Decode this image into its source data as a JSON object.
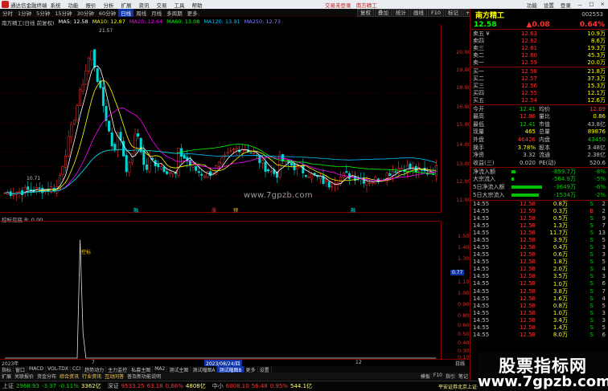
{
  "titlebar": {
    "app": "通达信金融终端",
    "menu": [
      "系统",
      "功能",
      "报价",
      "分析",
      "扩展",
      "资讯",
      "交易",
      "工具",
      "帮助"
    ],
    "notice": "交易未登录",
    "stock": "南方精工",
    "right": [
      "功能",
      "设置",
      "登录",
      "－",
      "□",
      "×"
    ]
  },
  "periodbar": {
    "items": [
      "分时",
      "1分钟",
      "5分钟",
      "15分钟",
      "30分钟",
      "60分钟",
      "日线",
      "周线",
      "月线",
      "多周期",
      "更多"
    ],
    "active": "日线"
  },
  "toolbtns": [
    "复权",
    "叠加",
    "统计",
    "画线",
    "F10",
    "标记",
    "+自选",
    "返回"
  ],
  "chart": {
    "title": "南方精工(日线 前复权)",
    "ma5": "MA5: 12.58",
    "ma10": "MA10: 12.87",
    "ma20": "MA20: 12.64",
    "ma60": "MA60: 13.08",
    "ma120": "MA120: 13.91",
    "ma250": "MA250: 12.73",
    "high_label": "21.57",
    "low_label": "10.71",
    "watermark": "www.7gpzb.com",
    "price_axis": [
      "20.00",
      "19.00",
      "18.00",
      "16.00",
      "15.00",
      "14.00",
      "13.00",
      "12.00",
      "11.00"
    ],
    "markers": [
      "融",
      "涨",
      "预",
      "融"
    ]
  },
  "sub": {
    "title": "控标见底  B: 0.00",
    "axis": [
      "1.50",
      "1.40",
      "1.30",
      "1.10",
      "1.00",
      "0.90",
      "0.80",
      "0.60",
      "0.50",
      "0.40",
      "0.30",
      "0.10"
    ],
    "marker": "0.77",
    "peak_label": "控标"
  },
  "dates": {
    "left": "2023年",
    "d1": "7",
    "cursor": "2023/08/24/四",
    "d2": "12",
    "right": "日线"
  },
  "indbar": {
    "items": [
      "指标",
      "窗口",
      "MACD",
      "VOL-TDX",
      "CCI",
      "趋势动力",
      "主力监控",
      "私募主图",
      "MA2",
      "测试主图",
      "测试幅图A",
      "测试幅图B",
      "更多",
      "设置"
    ],
    "active": "测试幅图B"
  },
  "tabbar": {
    "items": [
      "扩展",
      "关联报价",
      "资金分布",
      "综合资讯",
      "行业资讯",
      "互动问答",
      "普及新功能说明"
    ],
    "highlight": [
      "综合资讯",
      "行业资讯",
      "互动问答"
    ],
    "right": [
      "模板",
      "F10",
      "指引",
      "笔记"
    ]
  },
  "statusbar": {
    "sh": {
      "name": "上证",
      "val": "2968.93",
      "chg": "-3.37",
      "pct": "-0.11%",
      "amt": "3362亿"
    },
    "sz": {
      "name": "深证",
      "val": "9533.25",
      "chg": "63.18",
      "pct": "0.66%",
      "amt": "4808亿"
    },
    "zx": {
      "name": "中小",
      "val": "6008.10",
      "chg": "56.48",
      "pct": "0.95%",
      "amt": "544.1亿"
    },
    "news": "平安证券北京上证云行情"
  },
  "quote": {
    "name": "南方精工",
    "code": "002553",
    "price": "12.58",
    "change": "▲0.08",
    "pct": "0.64%",
    "asks": [
      {
        "label": "卖五 ¥",
        "price": "12.63",
        "vol": "10.9万"
      },
      {
        "label": "卖四",
        "price": "12.62",
        "vol": "8.6万"
      },
      {
        "label": "卖三",
        "price": "12.61",
        "vol": "19.3万"
      },
      {
        "label": "卖二",
        "price": "12.60",
        "vol": "45.3万"
      },
      {
        "label": "卖一",
        "price": "12.59",
        "vol": "20.0万"
      }
    ],
    "bids": [
      {
        "label": "买一",
        "price": "12.58",
        "vol": "21.8万"
      },
      {
        "label": "买二",
        "price": "12.57",
        "vol": "37.3万"
      },
      {
        "label": "买三",
        "price": "12.56",
        "vol": "15.3万"
      },
      {
        "label": "买四",
        "price": "12.55",
        "vol": "12.1万"
      },
      {
        "label": "买五",
        "price": "12.54",
        "vol": "12.6万"
      }
    ],
    "stats": [
      {
        "a": "今开",
        "b": "12.41",
        "c": "均价",
        "d": "12.69"
      },
      {
        "a": "最高",
        "b": "12.86",
        "c": "量比",
        "d": "0.86"
      },
      {
        "a": "最低",
        "b": "12.41",
        "c": "市值",
        "d": "43.8亿"
      },
      {
        "a": "现量",
        "b": "465",
        "c": "总量",
        "d": "89876"
      },
      {
        "a": "外盘",
        "b": "46426",
        "c": "内盘",
        "d": "43450"
      },
      {
        "a": "换手",
        "b": "3.78%",
        "c": "股本",
        "d": "3.48亿"
      },
      {
        "a": "净资",
        "b": "3.32",
        "c": "流通",
        "d": "2.38亿"
      },
      {
        "a": "收益(三)",
        "b": "0.020",
        "c": "PE(动)",
        "d": "520.6"
      }
    ],
    "flows": [
      {
        "a": "净流入额",
        "b": "-859.7万",
        "c": "-8%",
        "w": 0.12
      },
      {
        "a": "大宗流入",
        "b": "-564.9万",
        "c": "-5%",
        "w": 0.08
      },
      {
        "a": "5日净流入额",
        "b": "-3649万",
        "c": "-6%",
        "w": 0.95
      },
      {
        "a": "5日大宗流入",
        "b": "-1534万",
        "c": "-2%",
        "w": 0.85
      }
    ],
    "ticks": [
      {
        "t": "14:55",
        "p": "12.58",
        "v": "0.8万",
        "s": "S",
        "n": "2"
      },
      {
        "t": "14:55",
        "p": "12.59",
        "v": "0.3万",
        "s": "B",
        "n": "2"
      },
      {
        "t": "14:55",
        "p": "12.58",
        "v": "0.5万",
        "s": "S",
        "n": "9"
      },
      {
        "t": "14:55",
        "p": "12.58",
        "v": "1.3万",
        "s": "S",
        "n": "7"
      },
      {
        "t": "14:55",
        "p": "12.58",
        "v": "11.7万",
        "s": "S",
        "n": "13"
      },
      {
        "t": "14:55",
        "p": "12.58",
        "v": "3.9万",
        "s": "S",
        "n": "5"
      },
      {
        "t": "14:55",
        "p": "12.58",
        "v": "0.4万",
        "s": "S",
        "n": "3"
      },
      {
        "t": "14:55",
        "p": "12.58",
        "v": "0.6万",
        "s": "S",
        "n": "3"
      },
      {
        "t": "14:55",
        "p": "12.58",
        "v": "1.8万",
        "s": "S",
        "n": "5"
      },
      {
        "t": "14:55",
        "p": "12.58",
        "v": "2.0万",
        "s": "S",
        "n": "4"
      },
      {
        "t": "14:55",
        "p": "12.58",
        "v": "3.5万",
        "s": "S",
        "n": "3"
      },
      {
        "t": "14:55",
        "p": "12.58",
        "v": "1.0万",
        "s": "S",
        "n": "6"
      },
      {
        "t": "14:55",
        "p": "12.58",
        "v": "3.8万",
        "s": "S",
        "n": "7"
      },
      {
        "t": "14:55",
        "p": "12.58",
        "v": "1.6万",
        "s": "S",
        "n": "4"
      },
      {
        "t": "14:55",
        "p": "12.58",
        "v": "0.8万",
        "s": "S",
        "n": "5"
      },
      {
        "t": "14:55",
        "p": "12.58",
        "v": "1.0万",
        "s": "S",
        "n": "3"
      },
      {
        "t": "14:55",
        "p": "12.58",
        "v": "3.4万",
        "s": "S",
        "n": "3"
      },
      {
        "t": "14:55",
        "p": "12.58",
        "v": "1.4万",
        "s": "S",
        "n": "5"
      },
      {
        "t": "14:55",
        "p": "12.58",
        "v": "8.0万",
        "s": "S",
        "n": "6"
      }
    ]
  },
  "stamp": {
    "big": "股票指标网",
    "url": "www.7gpzb.com"
  }
}
